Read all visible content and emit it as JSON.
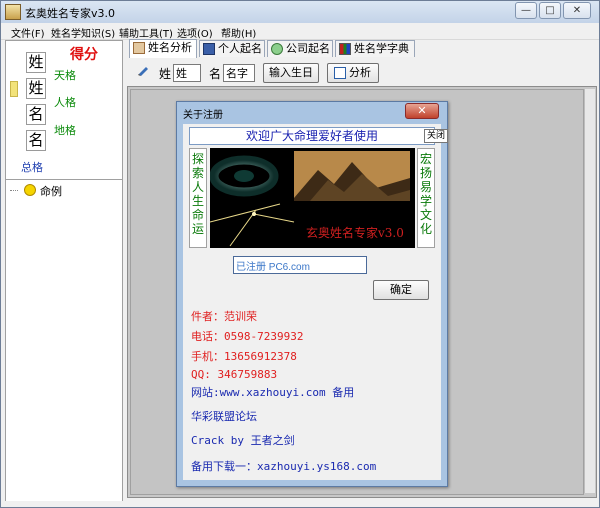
{
  "window": {
    "title": "玄奥姓名专家v3.0",
    "controls": {
      "minimize": "—",
      "maximize": "□",
      "close": "✕"
    }
  },
  "menu": [
    "文件(F)",
    "姓名学知识(S)",
    "辅助工具(T)",
    "选项(O)",
    "帮助(H)"
  ],
  "left": {
    "score_title": "得分",
    "cells": [
      "姓",
      "姓",
      "名",
      "名"
    ],
    "labels": {
      "tian": "天格",
      "ren": "人格",
      "di": "地格",
      "zong": "总格"
    },
    "tree_root": "命例"
  },
  "tabs": [
    "姓名分析",
    "个人起名",
    "公司起名",
    "姓名学字典"
  ],
  "toolbar": {
    "surname_label": "姓",
    "surname_value": "姓",
    "name_label": "名",
    "name_value": "名字",
    "birthday_button": "输入生日",
    "analyze_button": "分析"
  },
  "dialog": {
    "title": "关于注册",
    "close_label": "关闭",
    "tooltip": "关闭",
    "welcome": "欢迎广大命理爱好者使用",
    "left_vertical": "探索人生命运",
    "right_vertical": "宏扬易学文化",
    "banner_title": "玄奥姓名专家v3.0",
    "reg_input_value": "已注册 PC6.com",
    "ok_button": "确定",
    "info": [
      "件者：范训荣",
      "电话：0598-7239932",
      "手机：13656912378",
      "QQ:  346759883",
      "网站:www.xazhouyi.com  备用",
      "华彩联盟论坛",
      "Crack by 王者之剑",
      "备用下载一：xazhouyi.ys168.com"
    ]
  },
  "colors": {
    "red_text": "#e02020",
    "blue_text": "#1a2ab0",
    "green_text": "#0a8a0a",
    "dialog_frame": "#a9c4e2"
  }
}
